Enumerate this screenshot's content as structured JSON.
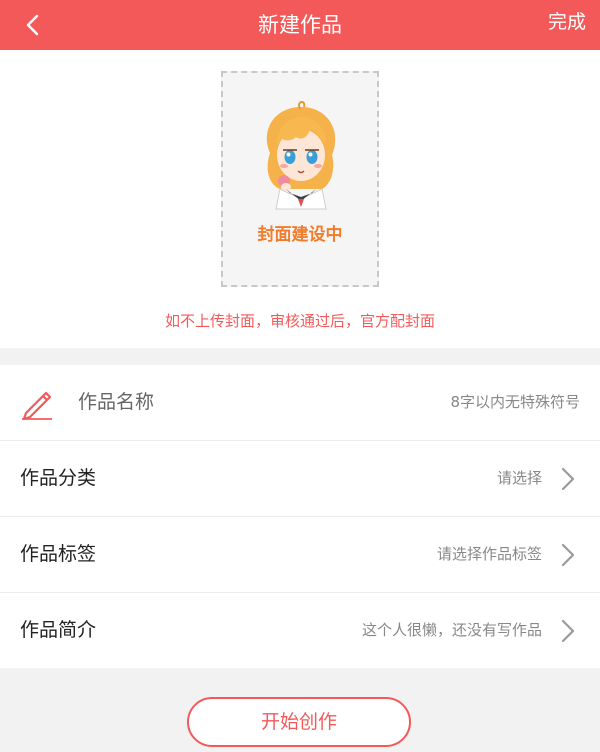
{
  "header": {
    "title": "新建作品",
    "done_label": "完成",
    "back_icon": "chevron-left-icon",
    "bg_color": "#f4595a"
  },
  "cover": {
    "label": "封面建设中",
    "hint": "如不上传封面，审核通过后，官方配封面",
    "label_color": "#f07c2c",
    "hint_color": "#f4595a"
  },
  "form": {
    "name": {
      "label": "作品名称",
      "placeholder": "8字以内无特殊符号",
      "icon": "pencil-icon"
    },
    "category": {
      "label": "作品分类",
      "value": "请选择"
    },
    "tags": {
      "label": "作品标签",
      "value": "请选择作品标签"
    },
    "intro": {
      "label": "作品简介",
      "value": "这个人很懒，还没有写作品"
    }
  },
  "start_button": {
    "label": "开始创作"
  }
}
